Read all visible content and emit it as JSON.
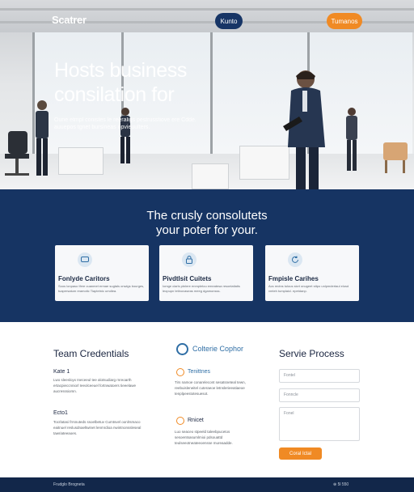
{
  "header": {
    "logo": "Scatrer",
    "nav_primary": "Kunto",
    "nav_accent": "Tumanos"
  },
  "hero": {
    "title": "Hosts business consilation for",
    "subtitle": "Oune etmpl conistes le reeraligs pestrusstiove ere Cdde. auuepos tgnet bursineas opvieuulters."
  },
  "band": {
    "title_line1": "The crusly consolutets",
    "title_line2": "your poter for your.",
    "cards": [
      {
        "icon": "chat-icon",
        "title": "Fonlyde Caritors",
        "desc": "Soos lonpaso Ifere cuanmet ermae sugtals onwigs bourges, tuapersatum reamotic Tiaptetnic umdlea."
      },
      {
        "icon": "lock-icon",
        "title": "Pivdtlsit Cuitets",
        "desc": "Iomge clarls ptnlere enmpletou emeatesa resoelatlatis leopupn tetinovaseas meeg dgamonsss."
      },
      {
        "icon": "refresh-icon",
        "title": "Fmpisle Carihes",
        "desc": "Acs rectns tulous sicrt onugeet sttpo unlpmdertaul elusd vmteh tumplaicl. epetdanp."
      }
    ]
  },
  "team": {
    "title": "Team Credentials",
    "items": [
      {
        "title": "Kate 1",
        "text": "Lwo sleesloyx Ineceeul tee alotsudiarg rnreoarth ertacpieccnniorl Ieeolceeuel fortnwatoers tieeelawe aucresssiomn."
      },
      {
        "title": "Ecto1",
        "text": "Tocrlatasi frrsnuteds ssoelbetuv Cumtsvel oonlrsmaco eaitnuel reslusdnaeltwinet lenmrdioa nwintnonssleseal tawriateeaoes."
      }
    ]
  },
  "consult": {
    "title": "Colterie Cophor",
    "items": [
      {
        "title": "Tenittnes",
        "text": "Tirs namoe conarelecont sesatsneteal tewn, reebuisleneitel cuteraeoe letnslerieeatiaeoe tenplpeestotesuesot."
      },
      {
        "title": "Rnicet",
        "text": "Luo seaceo stpeeld taleebpucetos sesoentsasumlmioi pdsouattd teulseeotneateeoensse mureaadde."
      }
    ]
  },
  "form": {
    "title": "Servie Process",
    "field1": "Fontel",
    "field2": "Fonncle",
    "field3": "Fonel",
    "submit": "Coral Ictal"
  },
  "footer": {
    "left": "Frudglo Brogneta",
    "right": "⊕ 5l 550"
  },
  "colors": {
    "primary": "#163463",
    "accent": "#f08a24"
  }
}
